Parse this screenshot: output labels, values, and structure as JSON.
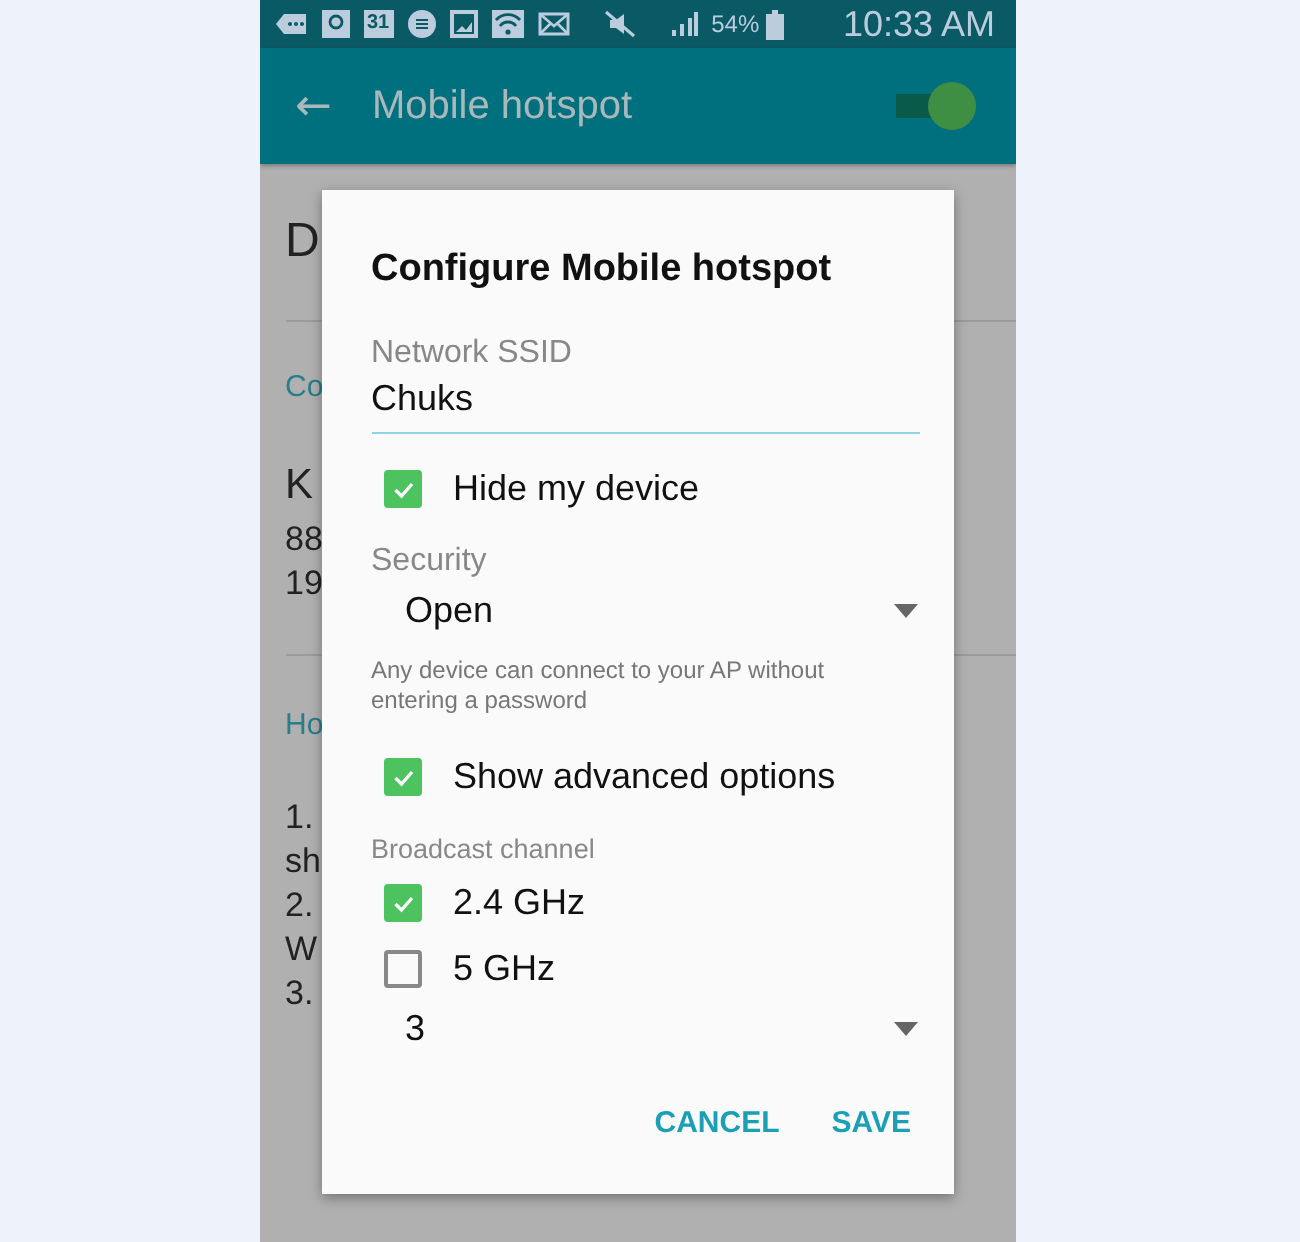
{
  "status_bar": {
    "calendar_day": "31",
    "battery": "54%",
    "time": "10:33 AM"
  },
  "app_bar": {
    "back": "←",
    "title": "Mobile hotspot",
    "switch_on": true
  },
  "background": {
    "groups": [
      {
        "items": [
          {
            "text": "D",
            "kind": "heading"
          }
        ]
      },
      {
        "items": [
          {
            "text": "Co",
            "kind": "section"
          },
          {
            "text": "K",
            "kind": "name"
          },
          {
            "text": "88",
            "kind": "detail"
          },
          {
            "text": "19",
            "kind": "detail"
          }
        ]
      },
      {
        "items": [
          {
            "text": "Ho",
            "kind": "section"
          },
          {
            "text": "1.",
            "kind": "step"
          },
          {
            "text": "sh",
            "kind": "detail"
          },
          {
            "text": "2.",
            "kind": "detail"
          },
          {
            "text": "W",
            "kind": "detail"
          },
          {
            "text": "3.",
            "kind": "detail"
          }
        ]
      }
    ]
  },
  "dialog": {
    "title": "Configure Mobile hotspot",
    "ssid": {
      "label": "Network SSID",
      "value": "Chuks"
    },
    "hide_device": {
      "label": "Hide my device",
      "checked": true
    },
    "security": {
      "label": "Security",
      "value": "Open",
      "note": "Any device can connect to your AP without entering a password"
    },
    "advanced": {
      "label": "Show advanced options",
      "checked": true
    },
    "broadcast_label": "Broadcast channel",
    "bands": [
      {
        "label": "2.4 GHz",
        "checked": true
      },
      {
        "label": "5 GHz",
        "checked": false
      }
    ],
    "channel": {
      "value": "3"
    },
    "buttons": [
      "CANCEL",
      "SAVE"
    ]
  }
}
